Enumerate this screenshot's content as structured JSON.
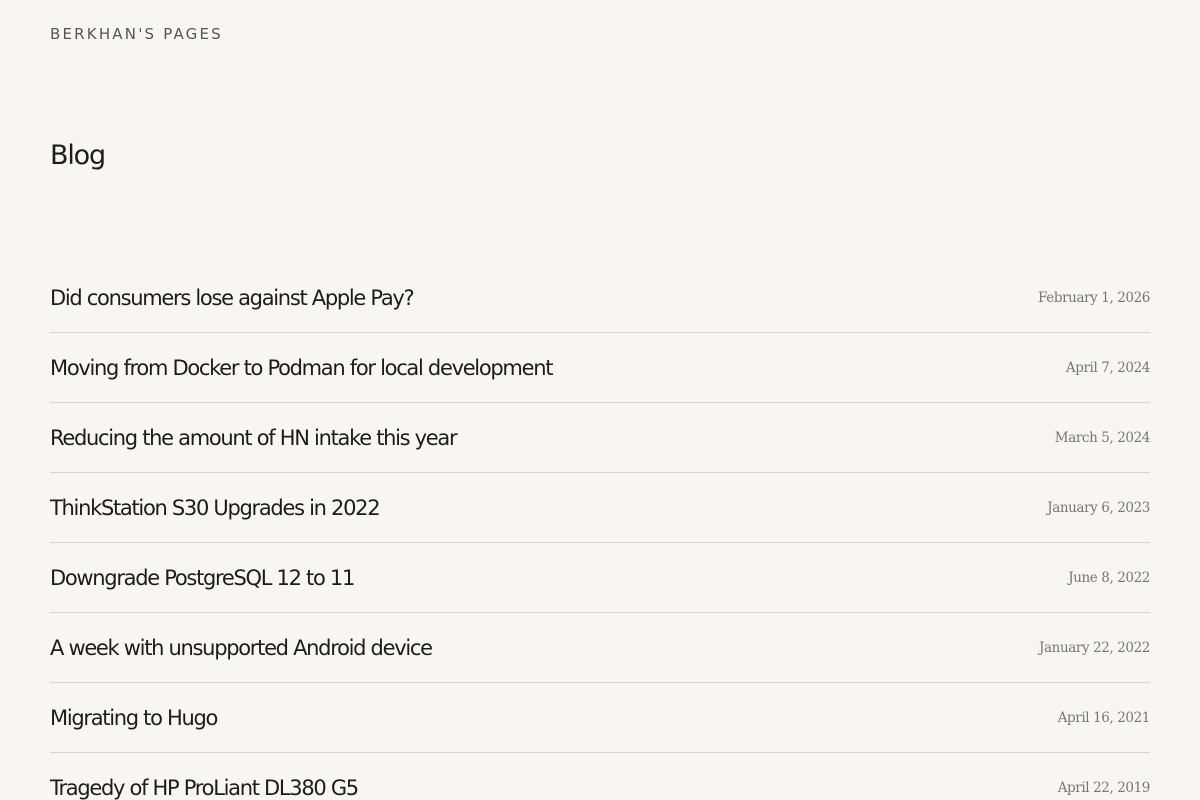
{
  "site": {
    "title": "BERKHAN'S PAGES"
  },
  "page": {
    "title": "Blog"
  },
  "posts": [
    {
      "title": "Did consumers lose against Apple Pay?",
      "date": "February 1, 2026"
    },
    {
      "title": "Moving from Docker to Podman for local development",
      "date": "April 7, 2024"
    },
    {
      "title": "Reducing the amount of HN intake this year",
      "date": "March 5, 2024"
    },
    {
      "title": "ThinkStation S30 Upgrades in 2022",
      "date": "January 6, 2023"
    },
    {
      "title": "Downgrade PostgreSQL 12 to 11",
      "date": "June 8, 2022"
    },
    {
      "title": "A week with unsupported Android device",
      "date": "January 22, 2022"
    },
    {
      "title": "Migrating to Hugo",
      "date": "April 16, 2021"
    },
    {
      "title": "Tragedy of HP ProLiant DL380 G5",
      "date": "April 22, 2019"
    }
  ]
}
